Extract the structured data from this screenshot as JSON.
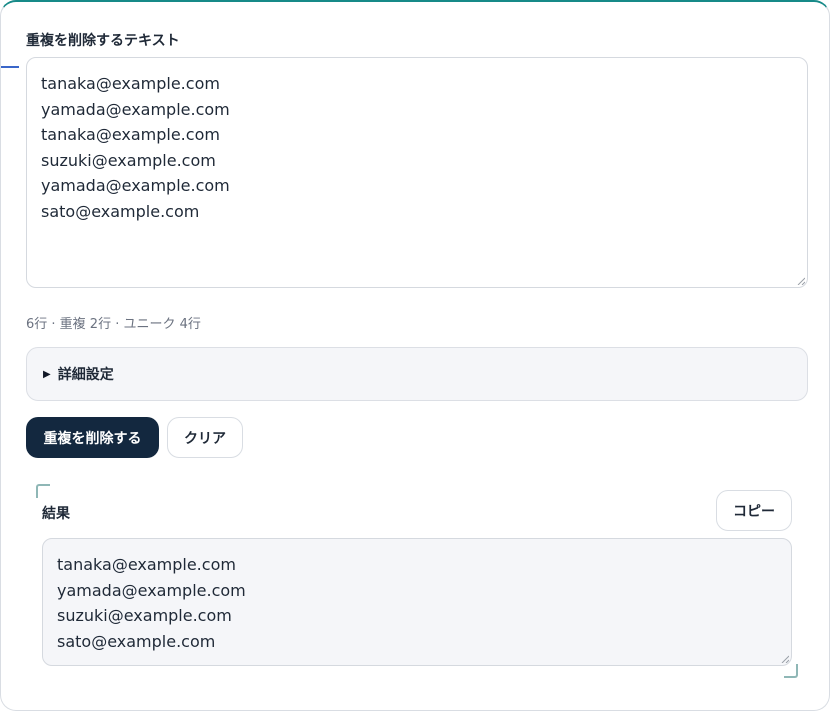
{
  "input": {
    "label": "重複を削除するテキスト",
    "lines": [
      "tanaka@example.com",
      "yamada@example.com",
      "tanaka@example.com",
      "suzuki@example.com",
      "yamada@example.com",
      "sato@example.com"
    ]
  },
  "stats": {
    "text": "6行 · 重複 2行 · ユニーク 4行"
  },
  "details": {
    "label": "詳細設定",
    "expanded": false
  },
  "actions": {
    "dedupe_label": "重複を削除する",
    "clear_label": "クリア"
  },
  "result": {
    "label": "結果",
    "copy_label": "コピー",
    "lines": [
      "tanaka@example.com",
      "yamada@example.com",
      "suzuki@example.com",
      "sato@example.com"
    ]
  },
  "colors": {
    "primary_button": "#13283f",
    "card_top_border": "#178a88",
    "left_accent": "#3a66c9",
    "result_background": "#f5f6f9"
  }
}
